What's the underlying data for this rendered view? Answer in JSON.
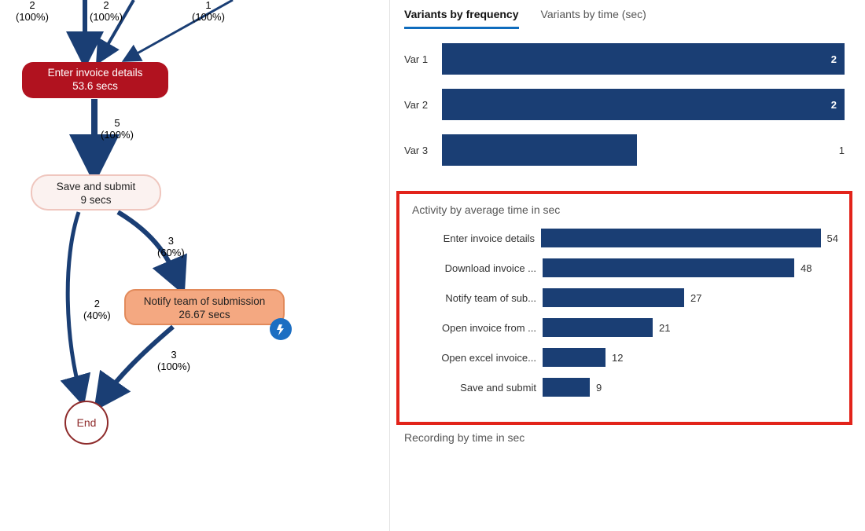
{
  "process": {
    "edges_top": [
      {
        "count": "2",
        "pct": "(100%)"
      },
      {
        "count": "2",
        "pct": "(100%)"
      },
      {
        "count": "1",
        "pct": "(100%)"
      }
    ],
    "node_enter": {
      "label": "Enter invoice details",
      "metric": "53.6 secs"
    },
    "edge_enter_save": {
      "count": "5",
      "pct": "(100%)"
    },
    "node_save": {
      "label": "Save and submit",
      "metric": "9 secs"
    },
    "edge_save_end": {
      "count": "2",
      "pct": "(40%)"
    },
    "edge_save_notify": {
      "count": "3",
      "pct": "(60%)"
    },
    "node_notify": {
      "label": "Notify team of submission",
      "metric": "26.67 secs"
    },
    "edge_notify_end": {
      "count": "3",
      "pct": "(100%)"
    },
    "node_end": {
      "label": "End"
    }
  },
  "tabs": {
    "freq": "Variants by frequency",
    "time": "Variants by time (sec)"
  },
  "chart_data": [
    {
      "type": "bar",
      "title": "Variants by frequency",
      "categories": [
        "Var 1",
        "Var 2",
        "Var 3"
      ],
      "values": [
        2,
        2,
        1
      ],
      "xlim": [
        0,
        2
      ]
    },
    {
      "type": "bar",
      "title": "Activity by average time in sec",
      "categories": [
        "Enter invoice details",
        "Download invoice ...",
        "Notify team of sub...",
        "Open invoice from ...",
        "Open excel invoice...",
        "Save and submit"
      ],
      "values": [
        54,
        48,
        27,
        21,
        12,
        9
      ],
      "xlim": [
        0,
        54
      ]
    }
  ],
  "bottom_panel_title": "Recording by time in sec"
}
